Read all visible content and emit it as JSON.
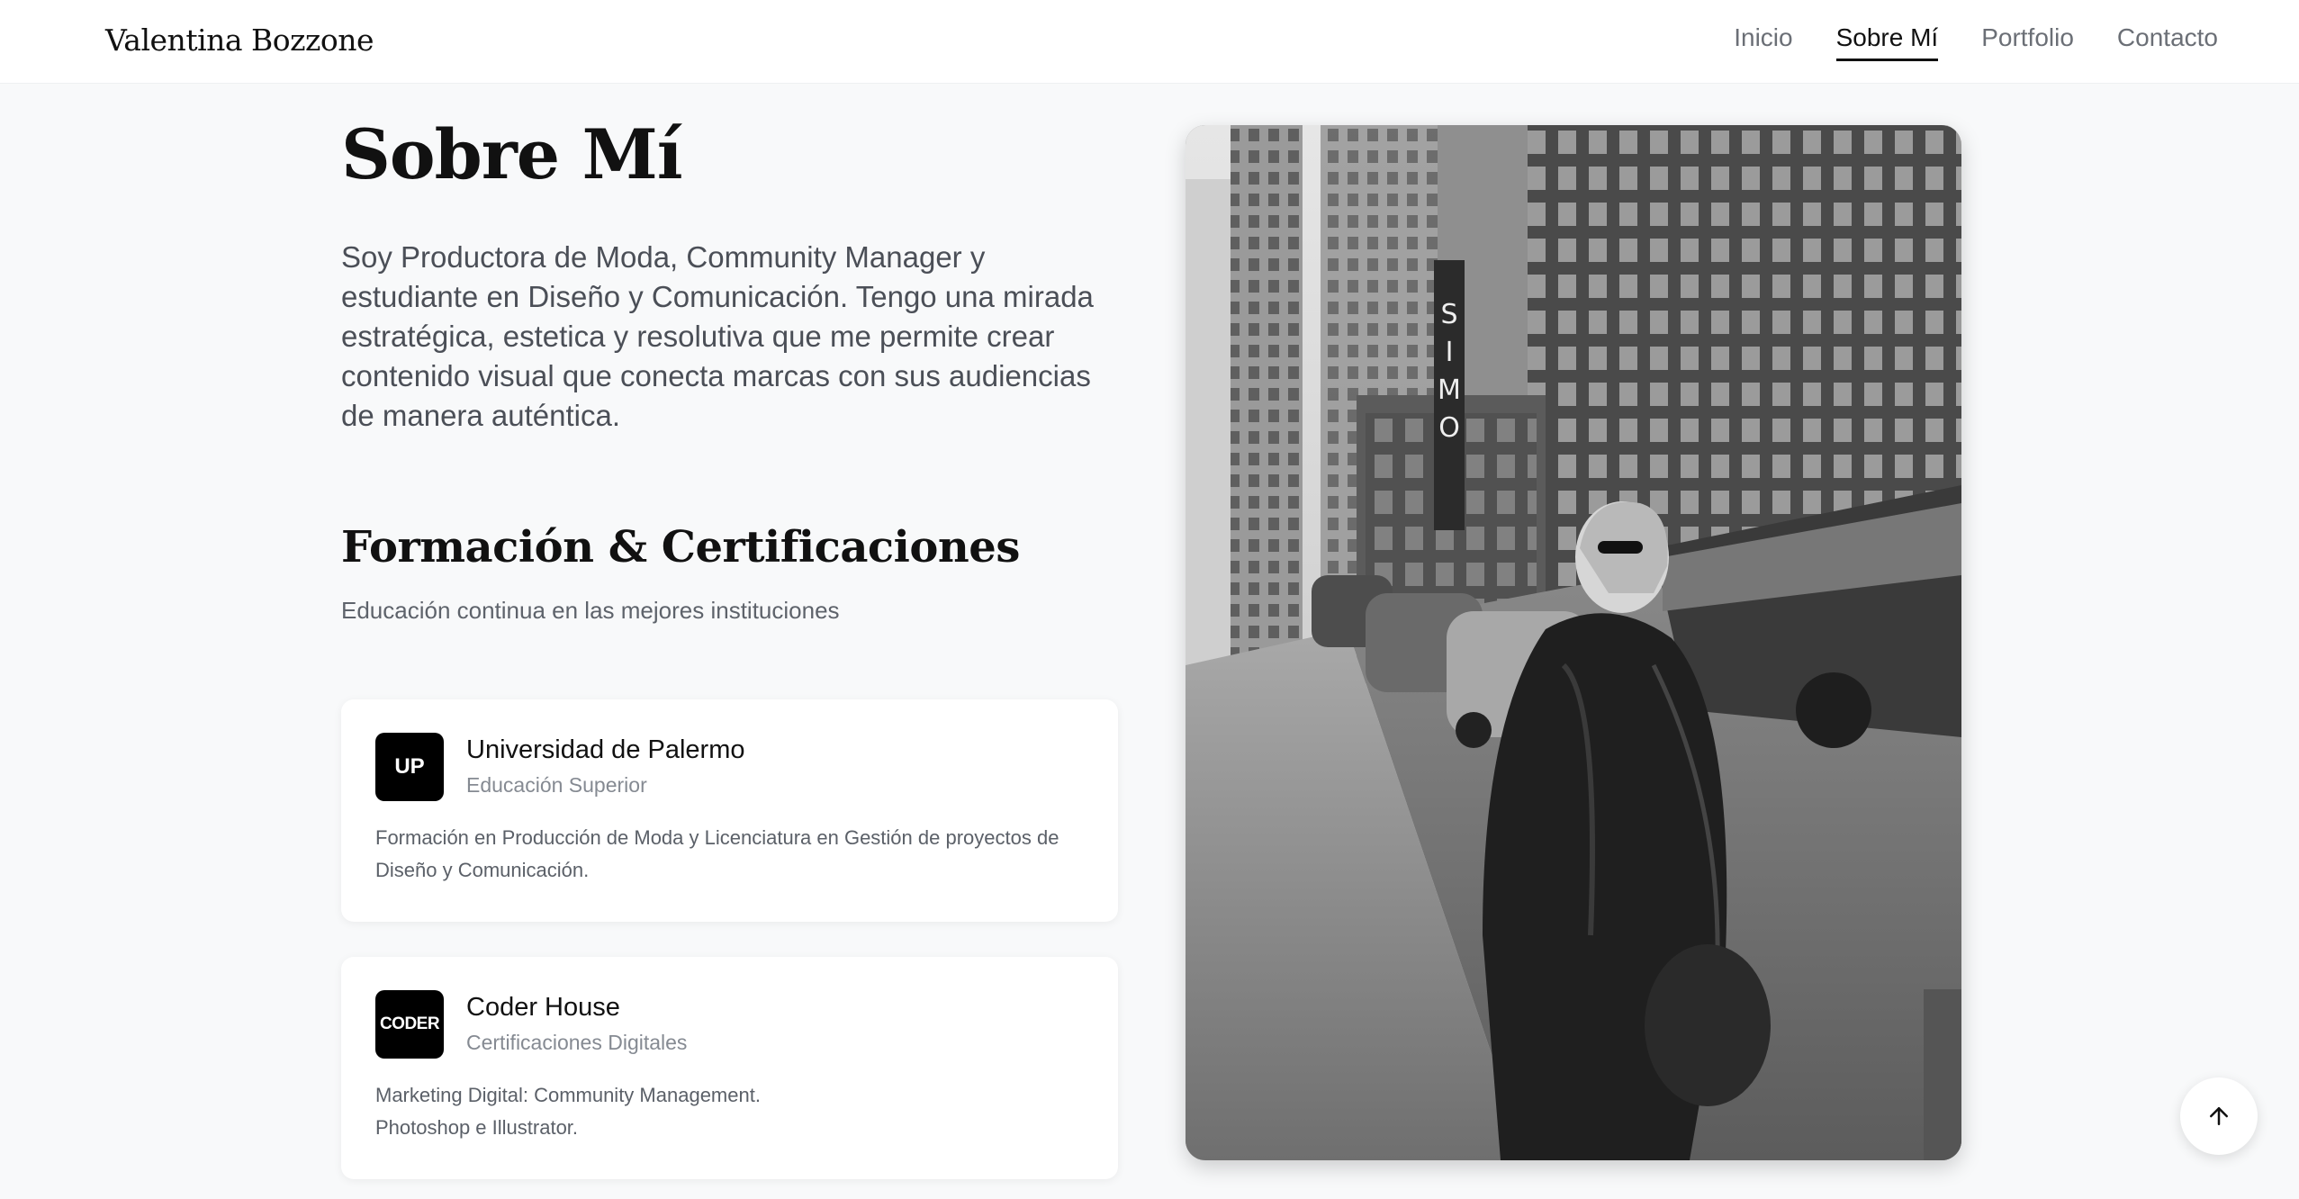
{
  "brand": {
    "name": "Valentina Bozzone"
  },
  "nav": {
    "items": [
      {
        "label": "Inicio",
        "active": false
      },
      {
        "label": "Sobre Mí",
        "active": true
      },
      {
        "label": "Portfolio",
        "active": false
      },
      {
        "label": "Contacto",
        "active": false
      }
    ]
  },
  "about": {
    "title": "Sobre Mí",
    "text": "Soy Productora de Moda, Community Manager y estudiante en Diseño y Comunicación. Tengo una mirada estratégica, estetica y resolutiva que me permite crear contenido visual que conecta marcas con sus audiencias de manera auténtica."
  },
  "education": {
    "title": "Formación & Certificaciones",
    "subtitle": "Educación continua en las mejores instituciones",
    "cards": [
      {
        "badge": "UP",
        "name": "Universidad de Palermo",
        "type": "Educación Superior",
        "description": "Formación en Producción de Moda y Licenciatura en Gestión de proyectos de Diseño y Comunicación."
      },
      {
        "badge": "CODER",
        "name": "Coder House",
        "type": "Certificaciones Digitales",
        "description": "Marketing Digital: Community Management.\nPhotoshop e Illustrator."
      }
    ]
  },
  "photo": {
    "sign_text": "SIMO"
  },
  "scroll_top": {
    "icon": "arrow-up-icon"
  },
  "colors": {
    "background": "#f8f9fa",
    "text": "#111111",
    "muted": "#5e636b",
    "badge": "#000000"
  }
}
